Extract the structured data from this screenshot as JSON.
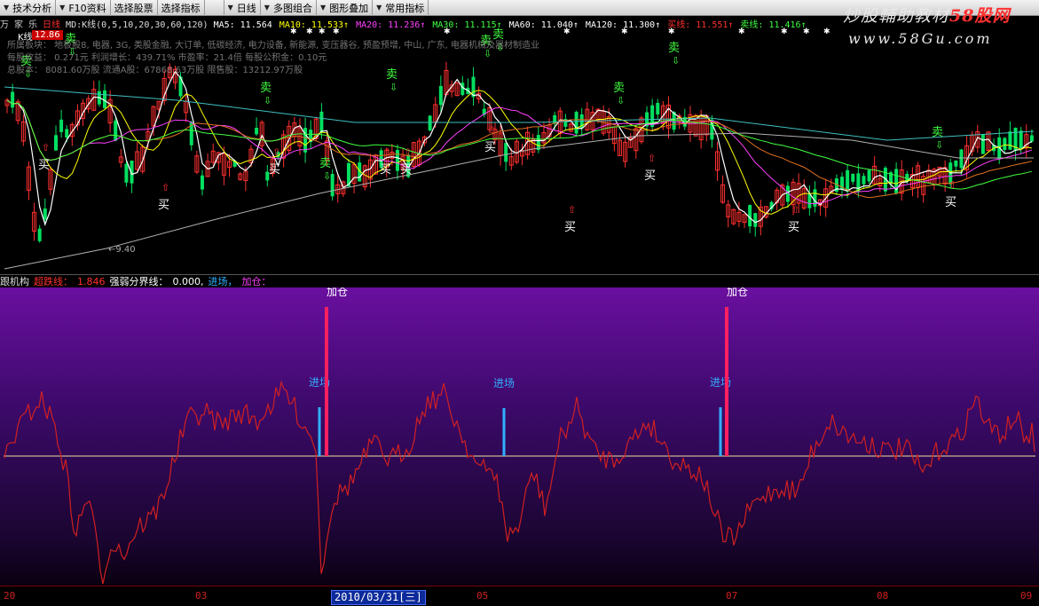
{
  "toolbar": {
    "items": [
      "技术分析",
      "F10资料",
      "选择股票",
      "选择指标",
      "日线",
      "多图组合",
      "图形叠加",
      "常用指标"
    ]
  },
  "main_chart": {
    "title_tag": "万 家 乐",
    "period": "日线",
    "ma_label": "MD:K线(0,5,10,20,30,60,120)",
    "ma_values": [
      {
        "label": "MA5:",
        "value": "11.564",
        "color": "#ffffff"
      },
      {
        "label": "MA10:",
        "value": "11.533",
        "color": "#ffff00"
      },
      {
        "label": "MA20:",
        "value": "11.236",
        "color": "#ff40ff"
      },
      {
        "label": "MA30:",
        "value": "11.115",
        "color": "#40ff40"
      },
      {
        "label": "MA60:",
        "value": "11.040",
        "color": "#ffffff"
      },
      {
        "label": "MA120:",
        "value": "11.300",
        "color": "#ffffff"
      },
      {
        "label": "买线:",
        "value": "11.551",
        "color": "#ff3030"
      },
      {
        "label": "卖线:",
        "value": "11.416",
        "color": "#40ff40"
      }
    ],
    "k_label": "K线",
    "k_price": "12.86",
    "info_lines": [
      "所属板块：  地板股8, 电器, 3G, 类股金融, 大订单, 低碳经济, 电力设备, 新能源, 变压器谷, 预盈预增, 中山, 广东, 电器机械及器材制造业",
      "每股收益：  0.271元     利润增长：439.71%    市盈率：21.4倍    每股公积金：0.10元",
      "总股本：  8081.60万股    流通A股：67868.63万股    限售股：13212.97万股"
    ],
    "low_label": "←9.40",
    "signal_buy": "买",
    "signal_sell": "卖"
  },
  "watermark": {
    "line1_a": "炒股輔助教材",
    "line1_b": "58股网",
    "line2": "www.58Gu.com"
  },
  "indicator": {
    "name": "跟机构",
    "l1_label": "超跌线：",
    "l1_value": "1.846",
    "l2_label": "强弱分界线：",
    "l2_value": "0.000,",
    "l3_label": "进场，",
    "l4_label": "加仓：",
    "jiacang": "加仓",
    "jinchang": "进场"
  },
  "date_axis": {
    "ticks": [
      "20",
      "03",
      "05",
      "07",
      "08",
      "09"
    ],
    "cursor": "2010/03/31[三]"
  },
  "colors": {
    "up": "#ff3030",
    "down": "#00e060",
    "ma5": "#ffffff",
    "ma10": "#ffff00",
    "ma20": "#ff40ff",
    "ma30": "#40ff40",
    "ma60": "#c0c0c0",
    "ind_line": "#d02020",
    "jinchang_bar": "#30b0ff",
    "jiacang_bar": "#ff2060"
  }
}
